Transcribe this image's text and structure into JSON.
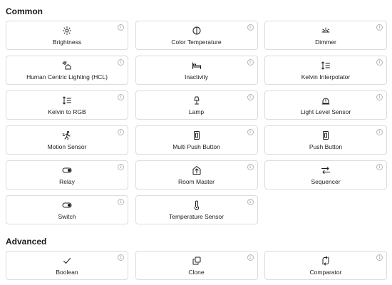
{
  "sections": [
    {
      "title": "Common",
      "items": [
        {
          "label": "Brightness",
          "icon": "sun-icon"
        },
        {
          "label": "Color Temperature",
          "icon": "half-circle-icon"
        },
        {
          "label": "Dimmer",
          "icon": "dimmer-sun-icon"
        },
        {
          "label": "Human Centric Lighting (HCL)",
          "icon": "home-sun-icon"
        },
        {
          "label": "Inactivity",
          "icon": "bed-icon"
        },
        {
          "label": "Kelvin Interpolator",
          "icon": "sort-arrows-icon"
        },
        {
          "label": "Kelvin to RGB",
          "icon": "sort-arrows-icon"
        },
        {
          "label": "Lamp",
          "icon": "lamp-icon"
        },
        {
          "label": "Light Level Sensor",
          "icon": "light-sensor-icon"
        },
        {
          "label": "Motion Sensor",
          "icon": "running-person-icon"
        },
        {
          "label": "Multi Push Button",
          "icon": "push-button-icon"
        },
        {
          "label": "Push Button",
          "icon": "push-button-icon"
        },
        {
          "label": "Relay",
          "icon": "toggle-icon"
        },
        {
          "label": "Room Master",
          "icon": "room-master-icon"
        },
        {
          "label": "Sequencer",
          "icon": "sequencer-icon"
        },
        {
          "label": "Switch",
          "icon": "toggle-icon"
        },
        {
          "label": "Temperature Sensor",
          "icon": "thermometer-icon"
        }
      ]
    },
    {
      "title": "Advanced",
      "items": [
        {
          "label": "Boolean",
          "icon": "checkmark-icon"
        },
        {
          "label": "Clone",
          "icon": "clone-icon"
        },
        {
          "label": "Comparator",
          "icon": "comparator-icon"
        }
      ]
    }
  ],
  "info_glyph": "i"
}
